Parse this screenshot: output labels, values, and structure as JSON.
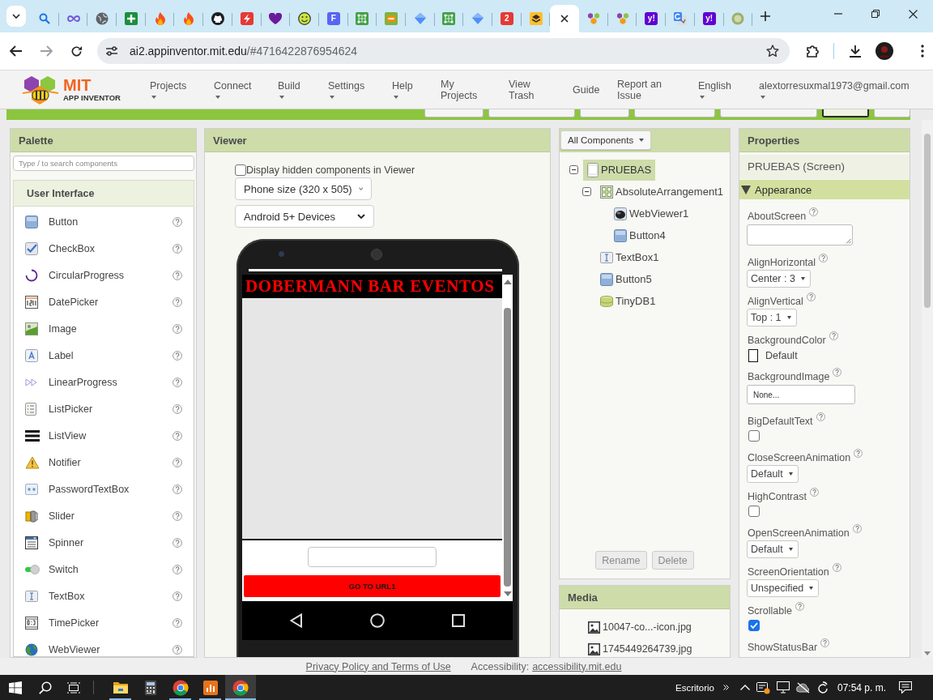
{
  "browser": {
    "tabs": [
      {
        "kind": "search",
        "selected": false
      },
      {
        "kind": "infinity",
        "selected": false
      },
      {
        "kind": "globe",
        "selected": false
      },
      {
        "kind": "sheet",
        "selected": false
      },
      {
        "kind": "flame",
        "selected": false
      },
      {
        "kind": "flame",
        "selected": false
      },
      {
        "kind": "dark-logo",
        "selected": false
      },
      {
        "kind": "bolt",
        "selected": false
      },
      {
        "kind": "heart",
        "selected": false
      },
      {
        "kind": "smiley",
        "selected": false
      },
      {
        "kind": "letter",
        "text": "F",
        "color": "#5865f2",
        "selected": false
      },
      {
        "kind": "circuit",
        "selected": false
      },
      {
        "kind": "robot",
        "selected": false
      },
      {
        "kind": "diamond",
        "selected": false
      },
      {
        "kind": "circuit",
        "selected": false
      },
      {
        "kind": "diamond",
        "selected": false
      },
      {
        "kind": "letter",
        "text": "2",
        "color": "#e53935",
        "selected": false
      },
      {
        "kind": "layers",
        "selected": false
      },
      {
        "selected": true
      },
      {
        "kind": "hexagons",
        "selected": false
      },
      {
        "kind": "hexagons",
        "selected": false
      },
      {
        "kind": "letter",
        "text": "y!",
        "color": "#6001d2",
        "selected": false
      },
      {
        "kind": "translate",
        "selected": false
      },
      {
        "kind": "letter",
        "text": "y!",
        "color": "#6001d2",
        "selected": false
      },
      {
        "kind": "circle",
        "selected": false
      }
    ],
    "address": {
      "domain": "ai2.appinventor.mit.edu",
      "path": "/#4716422876954624"
    }
  },
  "app_header": {
    "logo": {
      "title": "MIT",
      "subtitle": "APP INVENTOR"
    },
    "menu": [
      {
        "label": "Projects",
        "dropdown": true
      },
      {
        "label": "Connect",
        "dropdown": true
      },
      {
        "label": "Build",
        "dropdown": true
      },
      {
        "label": "Settings",
        "dropdown": true
      },
      {
        "label": "Help",
        "dropdown": true
      },
      {
        "label": "My Projects",
        "dropdown": false
      },
      {
        "label": "View Trash",
        "dropdown": false
      },
      {
        "label": "Guide",
        "dropdown": false
      },
      {
        "label": "Report an Issue",
        "dropdown": false
      },
      {
        "label": "English",
        "dropdown": true
      },
      {
        "label": "alextorresuxmal1973@gmail.com",
        "dropdown": true
      }
    ]
  },
  "toolbar": {
    "buttons": [
      {
        "selected": false
      },
      {
        "selected": false
      },
      {
        "selected": false
      },
      {
        "selected": false
      },
      {
        "selected": false
      },
      {
        "selected": true
      },
      {
        "selected": false
      }
    ]
  },
  "palette": {
    "title": "Palette",
    "search_placeholder": "Type / to search components",
    "category": "User Interface",
    "items": [
      {
        "kind": "button",
        "label": "Button"
      },
      {
        "kind": "checkbox",
        "label": "CheckBox"
      },
      {
        "kind": "circular-progress",
        "label": "CircularProgress"
      },
      {
        "kind": "date-picker",
        "label": "DatePicker"
      },
      {
        "kind": "image",
        "label": "Image"
      },
      {
        "kind": "label",
        "label": "Label"
      },
      {
        "kind": "linear-progress",
        "label": "LinearProgress"
      },
      {
        "kind": "list-picker",
        "label": "ListPicker"
      },
      {
        "kind": "list-view",
        "label": "ListView"
      },
      {
        "kind": "notifier",
        "label": "Notifier"
      },
      {
        "kind": "password",
        "label": "PasswordTextBox"
      },
      {
        "kind": "slider",
        "label": "Slider"
      },
      {
        "kind": "spinner",
        "label": "Spinner"
      },
      {
        "kind": "switch",
        "label": "Switch"
      },
      {
        "kind": "textbox",
        "label": "TextBox"
      },
      {
        "kind": "time-picker",
        "label": "TimePicker"
      },
      {
        "kind": "webviewer",
        "label": "WebViewer"
      }
    ]
  },
  "viewer": {
    "title": "Viewer",
    "show_hidden": {
      "label": "Display hidden components in Viewer",
      "checked": false
    },
    "size_select": "Phone size (320 x 505)",
    "device_select": "Android 5+ Devices",
    "phone": {
      "title": "DOBERMANN BAR EVENTOS",
      "button": "GO TO URL1"
    }
  },
  "components": {
    "filter": "All Components",
    "tree": [
      {
        "label": "PRUEBAS",
        "kind": "screen",
        "selected": true,
        "expanded": true,
        "children": [
          {
            "label": "AbsoluteArrangement1",
            "kind": "arrangement",
            "selected": false,
            "expanded": true,
            "children": [
              {
                "label": "WebViewer1",
                "kind": "webviewer",
                "selected": false
              },
              {
                "label": "Button4",
                "kind": "button",
                "selected": false
              }
            ]
          },
          {
            "label": "TextBox1",
            "kind": "textbox",
            "selected": false
          },
          {
            "label": "Button5",
            "kind": "button",
            "selected": false
          },
          {
            "label": "TinyDB1",
            "kind": "tinydb",
            "selected": false
          }
        ]
      }
    ],
    "actions": [
      {
        "label": "Rename",
        "disabled": true
      },
      {
        "label": "Delete",
        "disabled": true
      }
    ]
  },
  "media": {
    "title": "Media",
    "files": [
      "10047-co...-icon.jpg",
      "1745449264739.jpg"
    ]
  },
  "properties": {
    "title": "Properties",
    "component": "PRUEBAS (Screen)",
    "section": {
      "label": "Appearance",
      "expanded": true
    },
    "items": [
      {
        "kind": "textarea",
        "label": "AboutScreen"
      },
      {
        "kind": "select",
        "label": "AlignHorizontal",
        "value": "Center : 3"
      },
      {
        "kind": "select",
        "label": "AlignVertical",
        "value": "Top : 1"
      },
      {
        "kind": "color",
        "label": "BackgroundColor",
        "value": "Default"
      },
      {
        "kind": "text",
        "label": "BackgroundImage",
        "value": "None..."
      },
      {
        "kind": "checkbox",
        "label": "BigDefaultText",
        "checked": false
      },
      {
        "kind": "select",
        "label": "CloseScreenAnimation",
        "value": "Default"
      },
      {
        "kind": "checkbox",
        "label": "HighContrast",
        "checked": false
      },
      {
        "kind": "select",
        "label": "OpenScreenAnimation",
        "value": "Default"
      },
      {
        "kind": "select",
        "label": "ScreenOrientation",
        "value": "Unspecified"
      },
      {
        "kind": "checkbox",
        "label": "Scrollable",
        "checked": true
      },
      {
        "kind": "label",
        "label": "ShowStatusBar"
      }
    ]
  },
  "footer": {
    "privacy": "Privacy Policy and Terms of Use",
    "accessibility_label": "Accessibility:",
    "accessibility_link": "accessibility.mit.edu"
  },
  "taskbar": {
    "apps": [
      {
        "kind": "folder",
        "running": true,
        "selected": false
      },
      {
        "kind": "calculator",
        "running": false,
        "selected": false
      },
      {
        "kind": "chrome",
        "running": true,
        "selected": false
      },
      {
        "kind": "chart",
        "running": true,
        "selected": false
      },
      {
        "kind": "chrome",
        "running": true,
        "selected": true
      }
    ],
    "desktop_label": "Escritorio",
    "clock": "07:54 p. m."
  }
}
